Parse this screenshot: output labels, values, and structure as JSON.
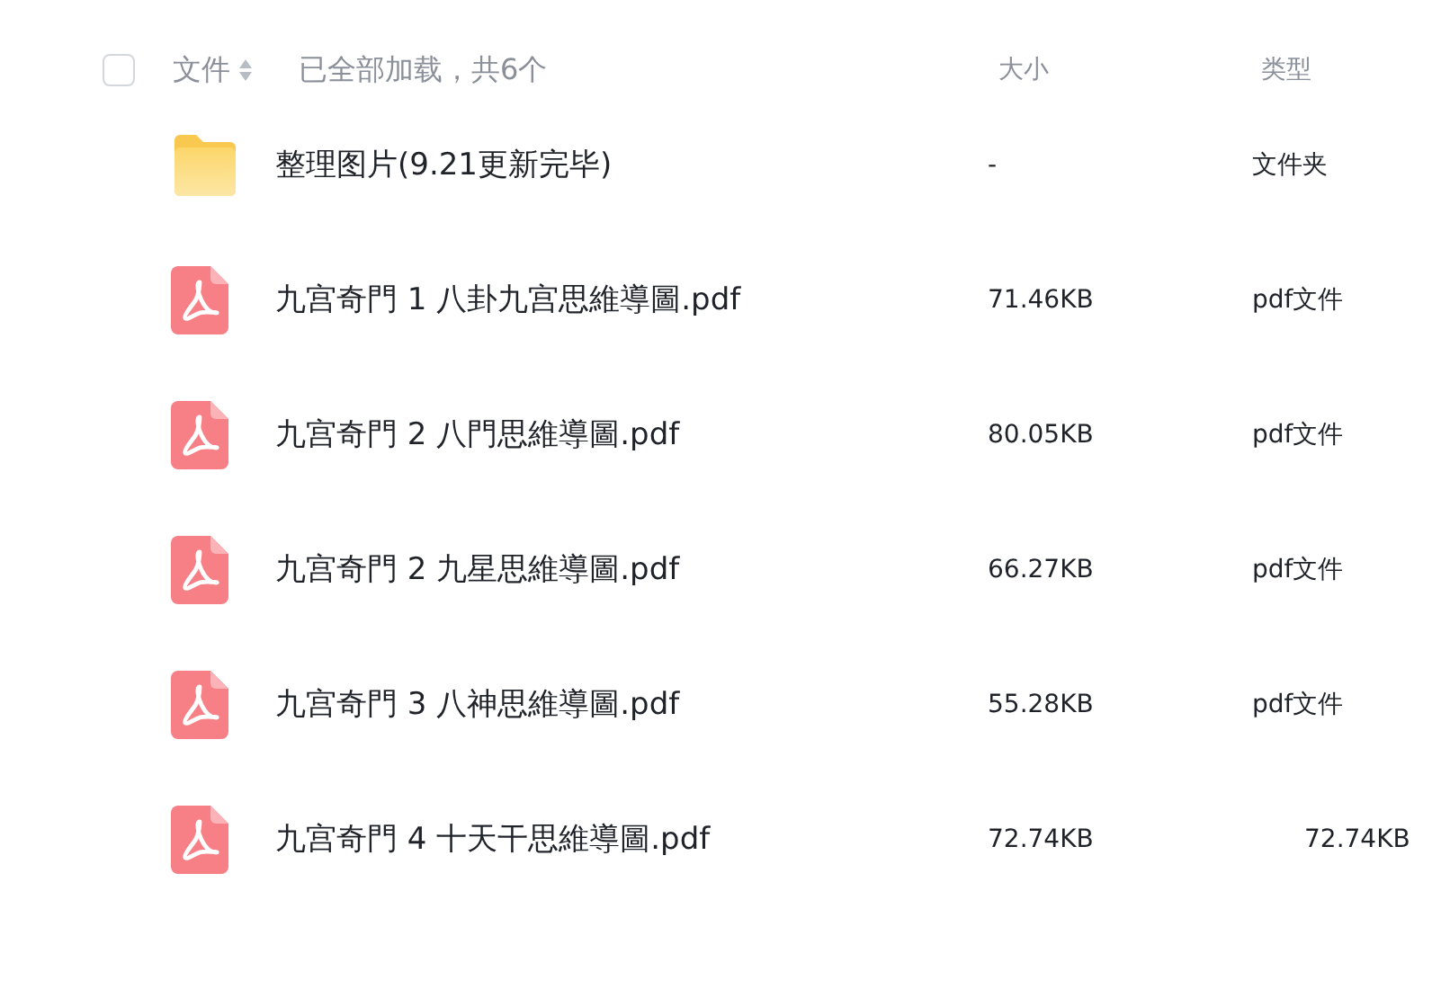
{
  "header": {
    "checked": false,
    "name_column": "文件",
    "status": "已全部加载，共6个",
    "size_column": "大小",
    "type_column": "类型"
  },
  "files": [
    {
      "kind": "folder",
      "name": "整理图片(9.21更新完毕)",
      "size": "-",
      "type": "文件夹"
    },
    {
      "kind": "pdf",
      "name": "九宫奇門 1 八卦九宫思維導圖.pdf",
      "size": "71.46KB",
      "type": "pdf文件"
    },
    {
      "kind": "pdf",
      "name": "九宫奇門 2 八門思維導圖.pdf",
      "size": "80.05KB",
      "type": "pdf文件"
    },
    {
      "kind": "pdf",
      "name": "九宫奇門 2 九星思維導圖.pdf",
      "size": "66.27KB",
      "type": "pdf文件"
    },
    {
      "kind": "pdf",
      "name": "九宫奇門 3 八神思維導圖.pdf",
      "size": "55.28KB",
      "type": "pdf文件"
    },
    {
      "kind": "pdf",
      "name": "九宫奇門 4 十天干思維導圖.pdf",
      "size": "72.74KB",
      "type": "72.74KB"
    }
  ]
}
